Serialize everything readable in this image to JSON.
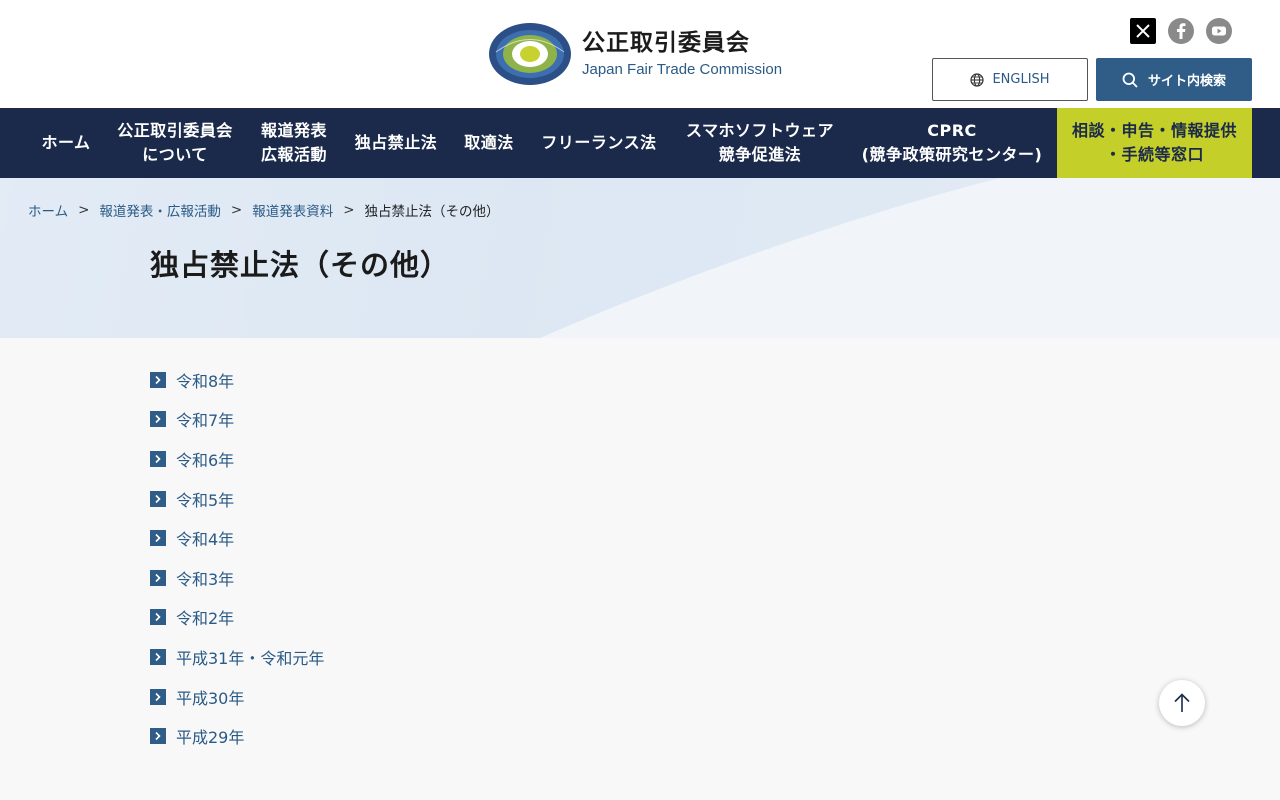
{
  "header": {
    "org_name_jp": "公正取引委員会",
    "org_name_en": "Japan Fair Trade Commission",
    "emblem_text": "JAPAN FAIR TRADE COMMISSION",
    "english_button": "ENGLISH",
    "search_button": "サイト内検索",
    "social_icons": [
      "x-icon",
      "facebook-icon",
      "youtube-icon"
    ]
  },
  "nav": {
    "items": [
      {
        "line1": "ホーム",
        "line2": ""
      },
      {
        "line1": "公正取引委員会",
        "line2": "について"
      },
      {
        "line1": "報道発表",
        "line2": "広報活動"
      },
      {
        "line1": "独占禁止法",
        "line2": ""
      },
      {
        "line1": "取適法",
        "line2": ""
      },
      {
        "line1": "フリーランス法",
        "line2": ""
      },
      {
        "line1": "スマホソフトウェア",
        "line2": "競争促進法"
      },
      {
        "line1": "CPRC",
        "line2": "(競争政策研究センター)"
      }
    ],
    "consult": {
      "line1": "相談・申告・情報提供",
      "line2": "・手続等窓口"
    }
  },
  "breadcrumb": {
    "items": [
      "ホーム",
      "報道発表・広報活動",
      "報道発表資料"
    ],
    "separator": ">",
    "current": "独占禁止法（その他）"
  },
  "page": {
    "title": "独占禁止法（その他）"
  },
  "years": [
    "令和8年",
    "令和7年",
    "令和6年",
    "令和5年",
    "令和4年",
    "令和3年",
    "令和2年",
    "平成31年・令和元年",
    "平成30年",
    "平成29年"
  ],
  "colors": {
    "nav_bg": "#1b2a4a",
    "accent_blue": "#2f5d87",
    "link": "#2a5a86",
    "consult_bg": "#c4cf2a",
    "page_bg": "#f8f8f8"
  }
}
